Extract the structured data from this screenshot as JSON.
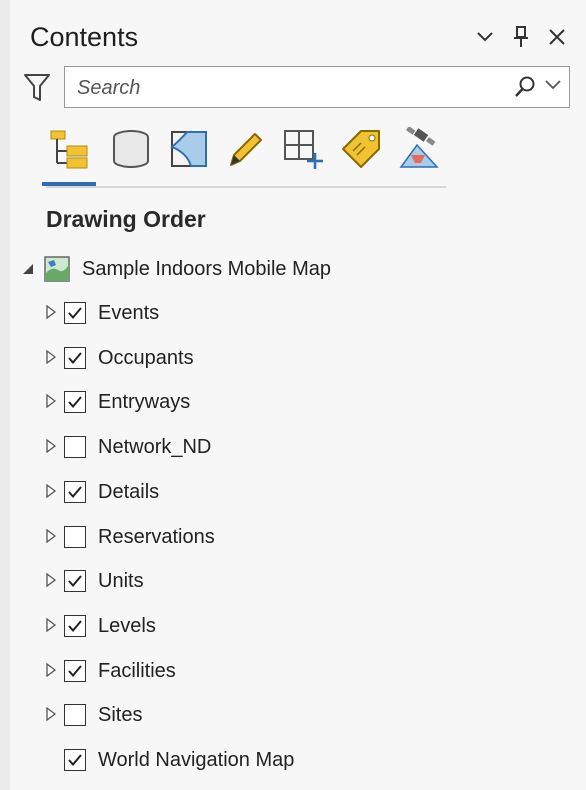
{
  "pane": {
    "title": "Contents",
    "controls": [
      "chevron-down-icon",
      "pin-icon",
      "close-icon"
    ]
  },
  "search": {
    "placeholder": "Search",
    "value": ""
  },
  "toolbar": {
    "tools": [
      {
        "name": "drawing-order-icon",
        "active": true
      },
      {
        "name": "data-source-icon",
        "active": false
      },
      {
        "name": "selection-icon",
        "active": false
      },
      {
        "name": "editing-icon",
        "active": false
      },
      {
        "name": "snapping-icon",
        "active": false
      },
      {
        "name": "labeling-icon",
        "active": false
      },
      {
        "name": "perspective-imagery-icon",
        "active": false
      }
    ]
  },
  "section": {
    "title": "Drawing Order"
  },
  "map": {
    "label": "Sample Indoors Mobile Map",
    "expanded": true
  },
  "layers": [
    {
      "label": "Events",
      "checked": true,
      "expandable": true
    },
    {
      "label": "Occupants",
      "checked": true,
      "expandable": true
    },
    {
      "label": "Entryways",
      "checked": true,
      "expandable": true
    },
    {
      "label": "Network_ND",
      "checked": false,
      "expandable": true
    },
    {
      "label": "Details",
      "checked": true,
      "expandable": true
    },
    {
      "label": "Reservations",
      "checked": false,
      "expandable": true
    },
    {
      "label": "Units",
      "checked": true,
      "expandable": true
    },
    {
      "label": "Levels",
      "checked": true,
      "expandable": true
    },
    {
      "label": "Facilities",
      "checked": true,
      "expandable": true
    },
    {
      "label": "Sites",
      "checked": false,
      "expandable": true
    },
    {
      "label": "World Navigation Map",
      "checked": true,
      "expandable": false
    }
  ],
  "colors": {
    "accent": "#2d6fb5",
    "folder": "#f1c232"
  }
}
